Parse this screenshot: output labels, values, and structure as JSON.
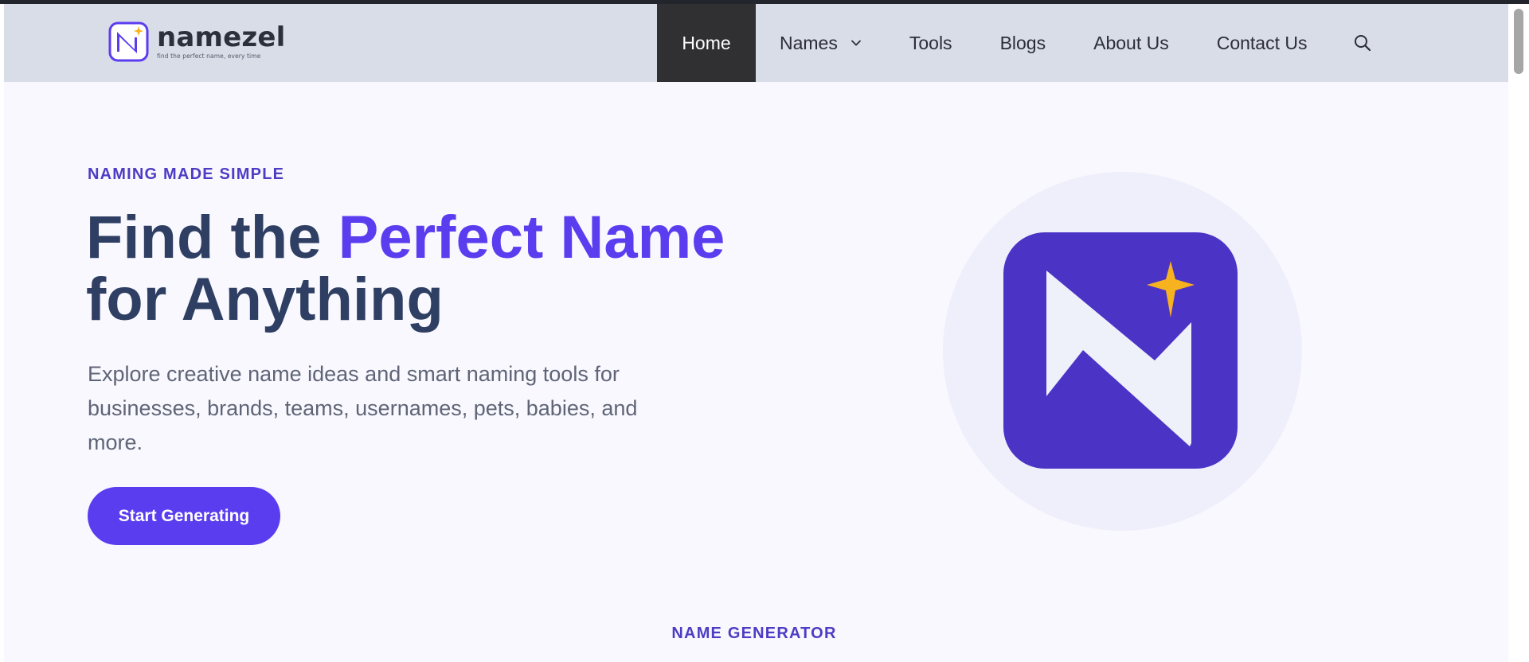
{
  "brand": {
    "name": "namezel",
    "tagline": "find the perfect name, every time",
    "accent_color": "#5b3df0",
    "star_color": "#f7b21f"
  },
  "nav": {
    "items": [
      {
        "label": "Home",
        "active": true
      },
      {
        "label": "Names",
        "has_dropdown": true
      },
      {
        "label": "Tools"
      },
      {
        "label": "Blogs"
      },
      {
        "label": "About Us"
      },
      {
        "label": "Contact Us"
      }
    ],
    "search_icon": "search-icon"
  },
  "hero": {
    "eyebrow": "NAMING MADE SIMPLE",
    "title_part1": "Find the ",
    "title_accent": "Perfect Name",
    "title_part2": "for Anything",
    "description": "Explore creative name ideas and smart naming tools for businesses, brands, teams, usernames, pets, babies, and more.",
    "cta_label": "Start Generating"
  },
  "next_section": {
    "label": "NAME GENERATOR"
  }
}
